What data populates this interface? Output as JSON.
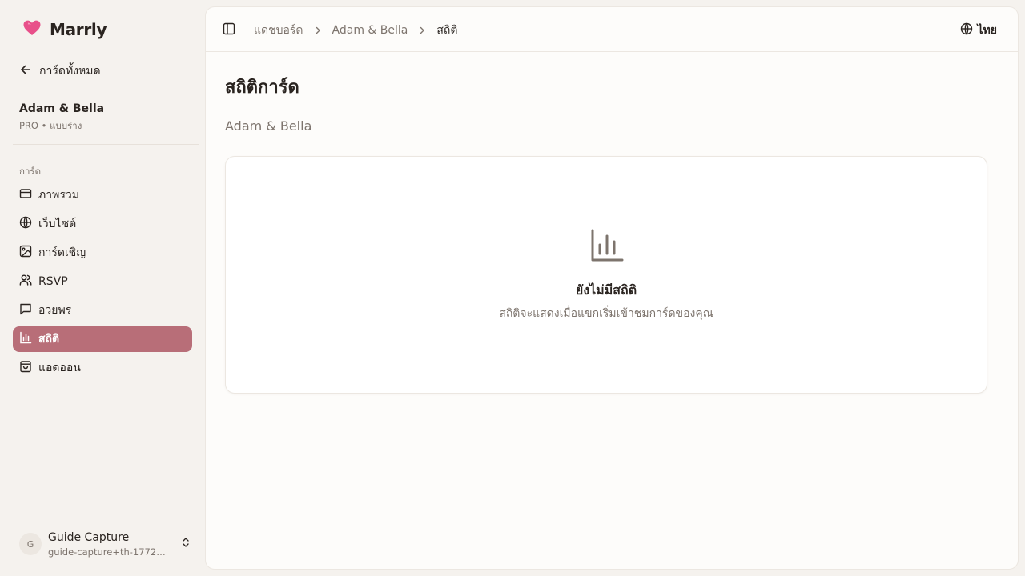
{
  "app": {
    "brand": "Marrly"
  },
  "sidebar": {
    "back_label": "การ์ดทั้งหมด",
    "card": {
      "title": "Adam & Bella",
      "subtitle": "PRO • แบบร่าง"
    },
    "section_label": "การ์ด",
    "items": [
      {
        "label": "ภาพรวม",
        "icon": "card-icon",
        "active": false
      },
      {
        "label": "เว็บไซต์",
        "icon": "globe-icon",
        "active": false
      },
      {
        "label": "การ์ดเชิญ",
        "icon": "image-icon",
        "active": false
      },
      {
        "label": "RSVP",
        "icon": "users-icon",
        "active": false
      },
      {
        "label": "อวยพร",
        "icon": "message-icon",
        "active": false
      },
      {
        "label": "สถิติ",
        "icon": "bar-chart-icon",
        "active": true
      },
      {
        "label": "แอดออน",
        "icon": "shopping-bag-icon",
        "active": false
      }
    ],
    "user": {
      "initial": "G",
      "name": "Guide Capture",
      "email": "guide-capture+th-17725..."
    }
  },
  "header": {
    "breadcrumbs": [
      "แดชบอร์ด",
      "Adam & Bella",
      "สถิติ"
    ],
    "language": "ไทย"
  },
  "main": {
    "title": "สถิติการ์ด",
    "subtitle": "Adam & Bella",
    "empty_state": {
      "icon": "bar-chart-icon",
      "title": "ยังไม่มีสถิติ",
      "text": "สถิติจะแสดงเมื่อแขกเริ่มเข้าชมการ์ดของคุณ"
    }
  },
  "colors": {
    "accent": "#b86e78",
    "brand_heart": "#e8508a",
    "sidebar_bg": "#f5f2ee",
    "content_bg": "#fdfcfa",
    "muted_text": "#7d746d"
  }
}
